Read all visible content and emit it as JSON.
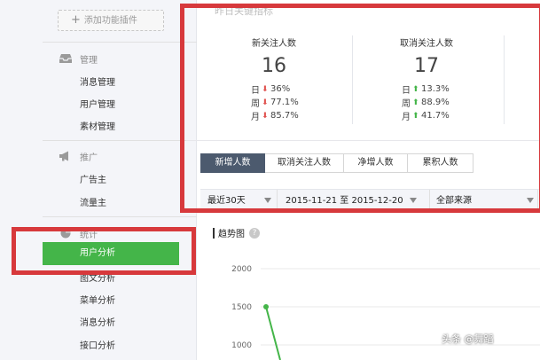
{
  "sidebar": {
    "add_plugin": "添加功能插件",
    "sections": [
      {
        "title": "管理",
        "icon": "inbox-icon",
        "items": [
          "消息管理",
          "用户管理",
          "素材管理"
        ]
      },
      {
        "title": "推广",
        "icon": "megaphone-icon",
        "items": [
          "广告主",
          "流量主"
        ]
      },
      {
        "title": "统计",
        "icon": "pie-chart-icon",
        "items": [
          "用户分析",
          "图文分析",
          "菜单分析",
          "消息分析",
          "接口分析"
        ]
      }
    ],
    "active_item": "用户分析"
  },
  "main": {
    "title": "昨日关键指标",
    "stats": [
      {
        "label": "新关注人数",
        "value": "16",
        "rows": [
          {
            "period": "日",
            "dir": "down",
            "pct": "36%"
          },
          {
            "period": "周",
            "dir": "down",
            "pct": "77.1%"
          },
          {
            "period": "月",
            "dir": "down",
            "pct": "85.7%"
          }
        ]
      },
      {
        "label": "取消关注人数",
        "value": "17",
        "rows": [
          {
            "period": "日",
            "dir": "up",
            "pct": "13.3%"
          },
          {
            "period": "周",
            "dir": "up",
            "pct": "88.9%"
          },
          {
            "period": "月",
            "dir": "up",
            "pct": "41.7%"
          }
        ]
      }
    ],
    "tabs": [
      "新增人数",
      "取消关注人数",
      "净增人数",
      "累积人数"
    ],
    "active_tab": 0,
    "filters": {
      "range": "最近30天",
      "dates": "2015-11-21 至 2015-12-20",
      "source": "全部来源"
    },
    "trend": {
      "title": "趋势图"
    }
  },
  "chart_data": {
    "type": "line",
    "title": "趋势图",
    "yticks": [
      2000,
      1500,
      1000
    ],
    "ylim": [
      1000,
      2000
    ],
    "series": [
      {
        "values": [
          1500,
          1000
        ]
      }
    ]
  },
  "watermark": "头条 @舞蹈",
  "colors": {
    "active_green": "#44b549",
    "tab_active": "#4c5a6e",
    "annotation_red": "#d7393c",
    "down_arrow": "#e0524f",
    "up_arrow": "#44b549"
  }
}
